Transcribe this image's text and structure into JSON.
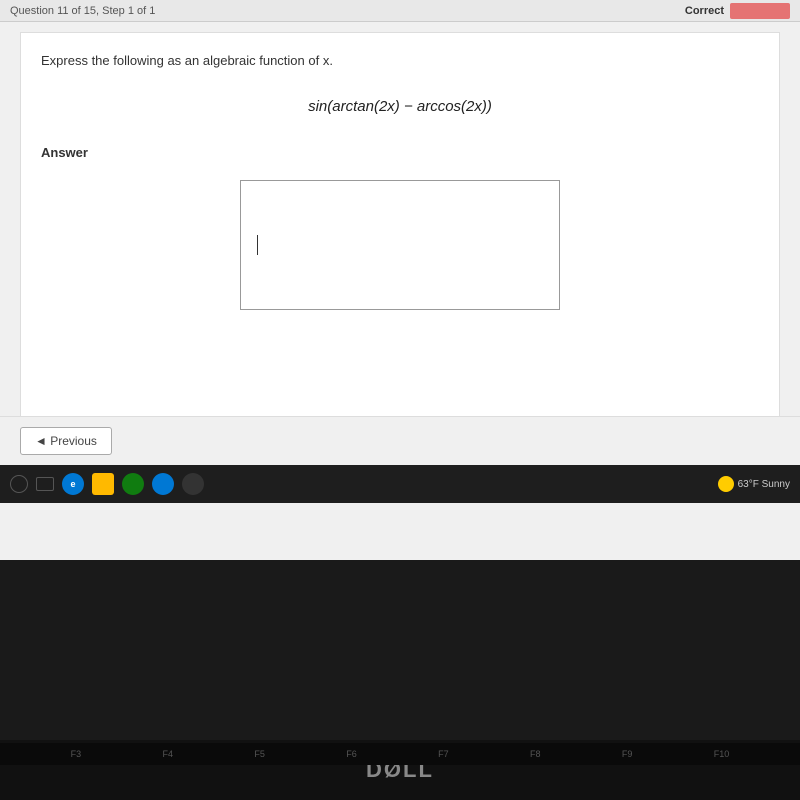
{
  "header": {
    "question_info": "Question 11 of 15, Step 1 of 1",
    "correct_label": "Correct"
  },
  "problem": {
    "instruction": "Express the following as an algebraic function of x.",
    "expression": "sin(arctan(2x) − arccos(2x))"
  },
  "answer_section": {
    "label": "Answer",
    "placeholder": ""
  },
  "navigation": {
    "previous_label": "◄ Previous"
  },
  "taskbar": {
    "weather": "63°F Sunny"
  },
  "dell": {
    "logo": "DØLL"
  },
  "fn_keys": [
    "F3",
    "F4",
    "F5",
    "F6",
    "F7",
    "F8",
    "F9",
    "F10"
  ]
}
